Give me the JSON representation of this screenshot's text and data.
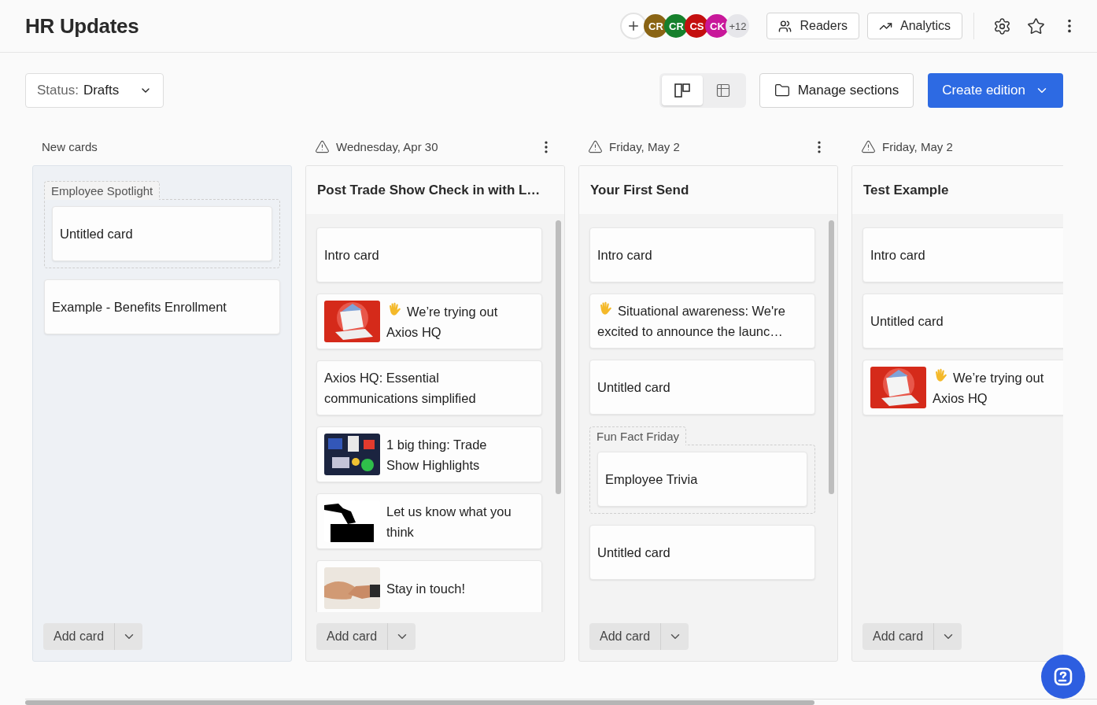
{
  "header": {
    "title": "HR Updates",
    "avatars": [
      {
        "initials": "CR",
        "color": "#8a6414"
      },
      {
        "initials": "CR",
        "color": "#16802c"
      },
      {
        "initials": "CS",
        "color": "#c40f0f"
      },
      {
        "initials": "CK",
        "color": "#c8189a"
      }
    ],
    "more_count": "+12",
    "buttons": [
      {
        "kind": "readers",
        "label": "Readers"
      },
      {
        "kind": "analytics",
        "label": "Analytics"
      }
    ]
  },
  "toolbar": {
    "status": {
      "prefix": "Status:",
      "value": "Drafts"
    },
    "views": [
      {
        "kind": "board",
        "selected": true
      },
      {
        "kind": "table",
        "selected": false
      }
    ],
    "manage": "Manage sections",
    "create": "Create edition"
  },
  "columns": [
    {
      "kind": "inbox",
      "header": "New cards",
      "warning": false,
      "menu": false,
      "add": "Add card",
      "scroll": false,
      "items": [
        {
          "kind": "group",
          "label": "Employee Spotlight",
          "children": [
            {
              "kind": "card",
              "title": "Untitled card"
            }
          ]
        },
        {
          "kind": "card",
          "title": "Example - Benefits Enrollment"
        }
      ]
    },
    {
      "kind": "edition",
      "header": "Wednesday, Apr 30",
      "warning": true,
      "menu": true,
      "title": "Post Trade Show Check in with L…",
      "add": "Add card",
      "scroll": true,
      "items": [
        {
          "kind": "card",
          "title": "Intro card"
        },
        {
          "kind": "card",
          "title": "We’re trying out Axios HQ",
          "picture": true,
          "wave": true
        },
        {
          "kind": "card",
          "title": "Axios HQ: Essential communications simplified"
        },
        {
          "kind": "card",
          "title": "1 big thing: Trade Show Highlights",
          "picture": true
        },
        {
          "kind": "card",
          "title": "Let us know what you think",
          "picture": true
        },
        {
          "kind": "card",
          "title": "Stay in touch!",
          "picture": true
        }
      ]
    },
    {
      "kind": "edition",
      "header": "Friday, May 2",
      "warning": true,
      "menu": true,
      "title": "Your First Send",
      "add": "Add card",
      "scroll": true,
      "items": [
        {
          "kind": "card",
          "title": "Intro card"
        },
        {
          "kind": "card",
          "title": "Situational awareness: We're excited to announce the launc…",
          "wave": true
        },
        {
          "kind": "card",
          "title": "Untitled card"
        },
        {
          "kind": "group",
          "label": "Fun Fact Friday",
          "children": [
            {
              "kind": "card",
              "title": "Employee Trivia"
            }
          ]
        },
        {
          "kind": "card",
          "title": "Untitled card"
        }
      ]
    },
    {
      "kind": "edition",
      "header": "Friday, May 2",
      "warning": true,
      "menu": false,
      "title": "Test Example",
      "add": "Add card",
      "scroll": false,
      "items": [
        {
          "kind": "card",
          "title": "Intro card"
        },
        {
          "kind": "card",
          "title": "Untitled card"
        },
        {
          "kind": "card",
          "title": "We’re trying out Axios HQ",
          "picture": true,
          "wave": true
        }
      ]
    }
  ]
}
